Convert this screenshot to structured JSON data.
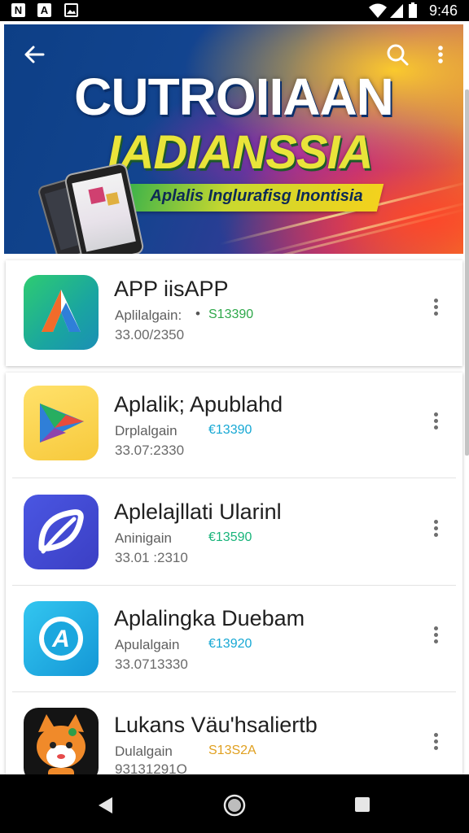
{
  "status_bar": {
    "time": "9:46",
    "left_icons": [
      "notification-n-icon",
      "notification-a-icon",
      "image-icon"
    ],
    "right_icons": [
      "wifi-icon",
      "signal-icon",
      "battery-icon"
    ]
  },
  "hero": {
    "title": "CUTROIIAAN",
    "subtitle": "IADIANSSIA",
    "ribbon": "Aplalis Inglurafisg Inontisia",
    "page_indicator": {
      "count": 3,
      "active": 0
    }
  },
  "apps": [
    {
      "title": "APP iisAPP",
      "subtitle": "Aplilalgain:",
      "price": "S13390",
      "price_color": "#2ea84a",
      "date": "33.00/2350",
      "icon": "triangle-a-icon"
    },
    {
      "title": "Aplalik; Apublahd",
      "subtitle": "Drplalgain",
      "price": "€13390",
      "price_color": "#16a8d4",
      "date": "33.07:2330",
      "icon": "play-triangle-icon"
    },
    {
      "title": "Aplelajllati Ularinl",
      "subtitle": "Aninigain",
      "price": "€13590",
      "price_color": "#18b47a",
      "date": "33.01 :2310",
      "icon": "leaf-swirl-icon"
    },
    {
      "title": "Aplalingka Duebam",
      "subtitle": "Apulalgain",
      "price": "€13920",
      "price_color": "#16a8d4",
      "date": "33.0713330",
      "icon": "circle-a-icon"
    },
    {
      "title": "Lukans Väu'hsaliertb",
      "subtitle": "Dulalgain",
      "price": "S13S2A",
      "price_color": "#e0a020",
      "date": "93131291O",
      "icon": "fox-mascot-icon"
    }
  ],
  "colors": {
    "status_bar": "#000000",
    "nav_bar": "#000000",
    "hero_title": "#ffffff",
    "hero_subtitle": "#e9e43a"
  }
}
